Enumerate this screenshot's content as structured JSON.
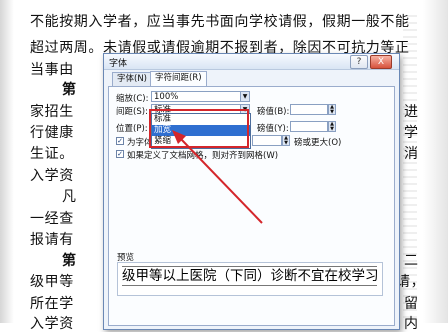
{
  "document": {
    "lines": [
      "不能按期入学者，应当事先书面向学校请假，假期一般不能",
      "超过两周。未请假或请假逾期不报到者，除因不可抗力等正",
      "当事由",
      "第",
      "家招生",
      "行健康",
      "生证。",
      "入学资",
      "凡",
      "一经查",
      "报请有",
      "第",
      "级甲等",
      "所在学",
      "入学资"
    ],
    "right_fragments": [
      "进",
      "学",
      "消",
      "二",
      "请，",
      "留",
      "内"
    ]
  },
  "dialog": {
    "title": "字体",
    "help_button": "?",
    "close_button": "X",
    "tabs": [
      "字体(N)",
      "字符间距(R)"
    ],
    "fields": {
      "scale_label": "缩放(C):",
      "scale_value": "100%",
      "spacing_label": "间距(S):",
      "spacing_value": "标准",
      "spacing_amount_label": "磅值(B):",
      "position_label": "位置(P):",
      "position_amount_label": "磅值(Y):",
      "kerning_label": "为字体调整字间距(K):",
      "kerning_suffix": "磅或更大(O)",
      "grid_label": "如果定义了文档网格，则对齐到网格(W)",
      "preview_label": "预览"
    },
    "dropdown_options": [
      "标准",
      "加宽",
      "紧缩"
    ],
    "selected_option": "加宽",
    "preview_text": "级甲等以上医院（下同）诊断不宜在校学习",
    "colors": {
      "highlight": "#2f6fd0",
      "annotation": "#d4262b"
    }
  }
}
